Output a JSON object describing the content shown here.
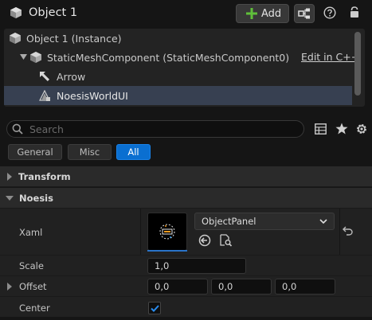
{
  "header": {
    "title": "Object 1",
    "add_label": "Add"
  },
  "tree": {
    "items": [
      {
        "label": "Object 1 (Instance)"
      },
      {
        "label": "StaticMeshComponent (StaticMeshComponent0)",
        "link": "Edit in C++"
      },
      {
        "label": "Arrow"
      },
      {
        "label": "NoesisWorldUI"
      }
    ]
  },
  "search": {
    "placeholder": "Search"
  },
  "filters": {
    "general": "General",
    "misc": "Misc",
    "all": "All",
    "active": "All"
  },
  "sections": {
    "transform": "Transform",
    "noesis": "Noesis"
  },
  "props": {
    "xaml_label": "Xaml",
    "xaml_value": "ObjectPanel",
    "scale_label": "Scale",
    "scale_value": "1,0",
    "offset_label": "Offset",
    "offset_x": "0,0",
    "offset_y": "0,0",
    "offset_z": "0,0",
    "center_label": "Center",
    "center_checked": true
  },
  "colors": {
    "accent": "#0a6fd1",
    "selection": "#374051"
  }
}
